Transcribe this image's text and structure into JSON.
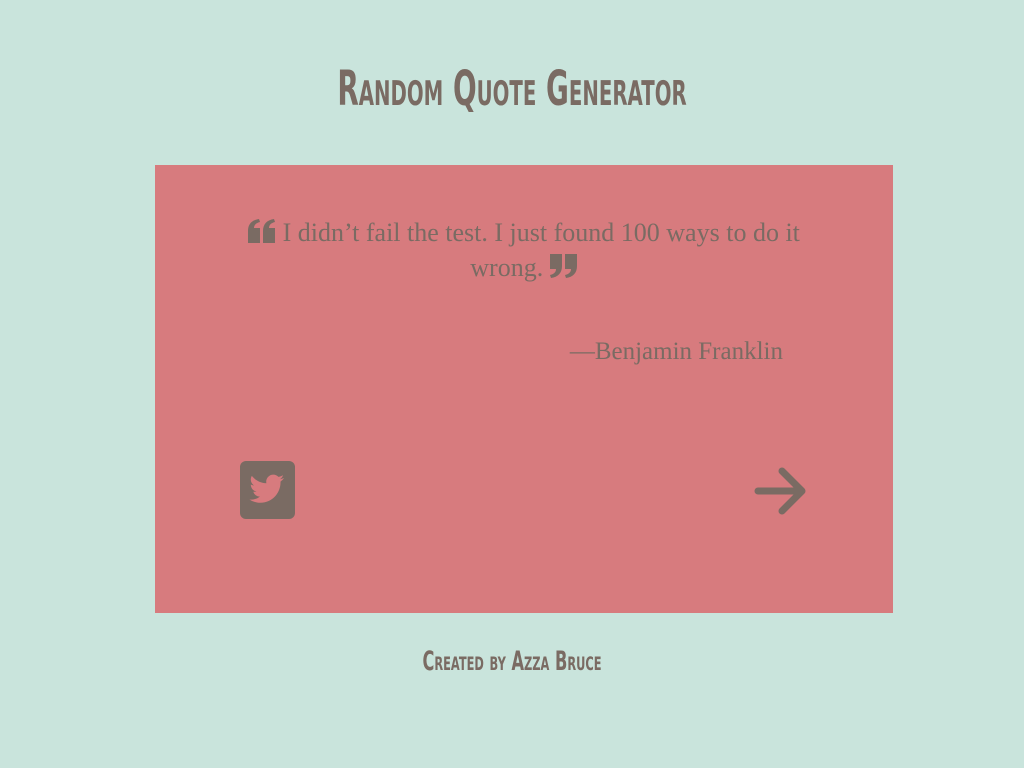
{
  "header": {
    "title": "Random Quote Generator"
  },
  "quote": {
    "text": "I didn’t fail the test. I just found 100 ways to do it wrong.",
    "author": "—Benjamin Franklin",
    "open_icon": "quote-left-icon",
    "close_icon": "quote-right-icon"
  },
  "actions": {
    "tweet_icon": "twitter-icon",
    "next_icon": "arrow-right-icon"
  },
  "footer": {
    "credit": "Created by Azza Bruce"
  },
  "colors": {
    "background": "#c9e4dc",
    "card": "#d77b7e",
    "text": "#7a6b63"
  }
}
